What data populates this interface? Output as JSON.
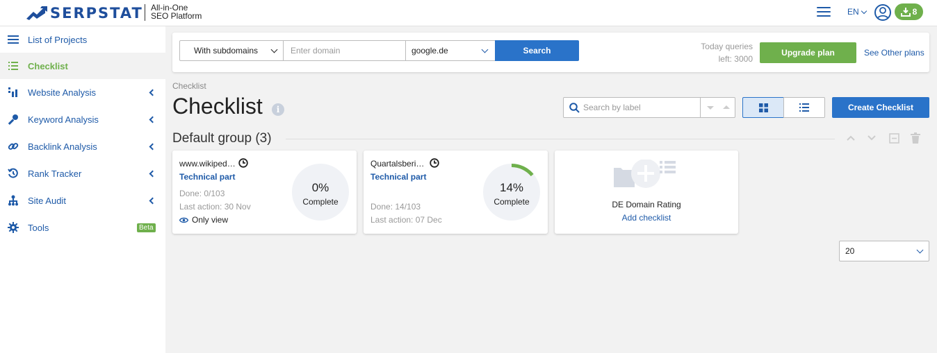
{
  "header": {
    "logo_text": "SERPSTAT",
    "tagline_line1": "All-in-One",
    "tagline_line2": "SEO Platform",
    "language": "EN",
    "notification_count": "8"
  },
  "sidebar": {
    "items": [
      {
        "label": "List of Projects",
        "icon": "list-icon",
        "active": false
      },
      {
        "label": "Checklist",
        "icon": "checklist-icon",
        "active": true
      },
      {
        "label": "Website Analysis",
        "icon": "bar-chart-icon",
        "active": false
      },
      {
        "label": "Keyword Analysis",
        "icon": "key-icon",
        "active": false
      },
      {
        "label": "Backlink Analysis",
        "icon": "link-icon",
        "active": false
      },
      {
        "label": "Rank Tracker",
        "icon": "history-icon",
        "active": false
      },
      {
        "label": "Site Audit",
        "icon": "sitemap-icon",
        "active": false
      },
      {
        "label": "Tools",
        "icon": "gear-icon",
        "active": false,
        "badge": "Beta"
      }
    ]
  },
  "search": {
    "subdomain_select": "With subdomains",
    "domain_placeholder": "Enter domain",
    "search_engine": "google.de",
    "search_button": "Search",
    "queries_line1": "Today queries",
    "queries_line2": "left: 3000",
    "upgrade_button": "Upgrade plan",
    "other_plans_link": "See Other plans"
  },
  "page": {
    "breadcrumb": "Checklist",
    "title": "Checklist",
    "label_search_placeholder": "Search by label",
    "create_button": "Create Checklist"
  },
  "group": {
    "title": "Default group (3)"
  },
  "cards": [
    {
      "title": "www.wikiped…",
      "type": "Technical part",
      "done": "Done: 0/103",
      "last_action": "Last action: 30 Nov",
      "access": "Only view",
      "percent_label": "0%",
      "progress": 0,
      "complete_label": "Complete"
    },
    {
      "title": "Quartalsberi…",
      "type": "Technical part",
      "done": "Done: 14/103",
      "last_action": "Last action: 07 Dec",
      "percent_label": "14%",
      "progress": 0.14,
      "complete_label": "Complete"
    }
  ],
  "add_card": {
    "name": "DE Domain Rating",
    "link": "Add checklist"
  },
  "pagination": {
    "per_page": "20"
  },
  "colors": {
    "brand_blue": "#2a73c9",
    "link_blue": "#1e5aa8",
    "accent_green": "#6fb04c"
  }
}
